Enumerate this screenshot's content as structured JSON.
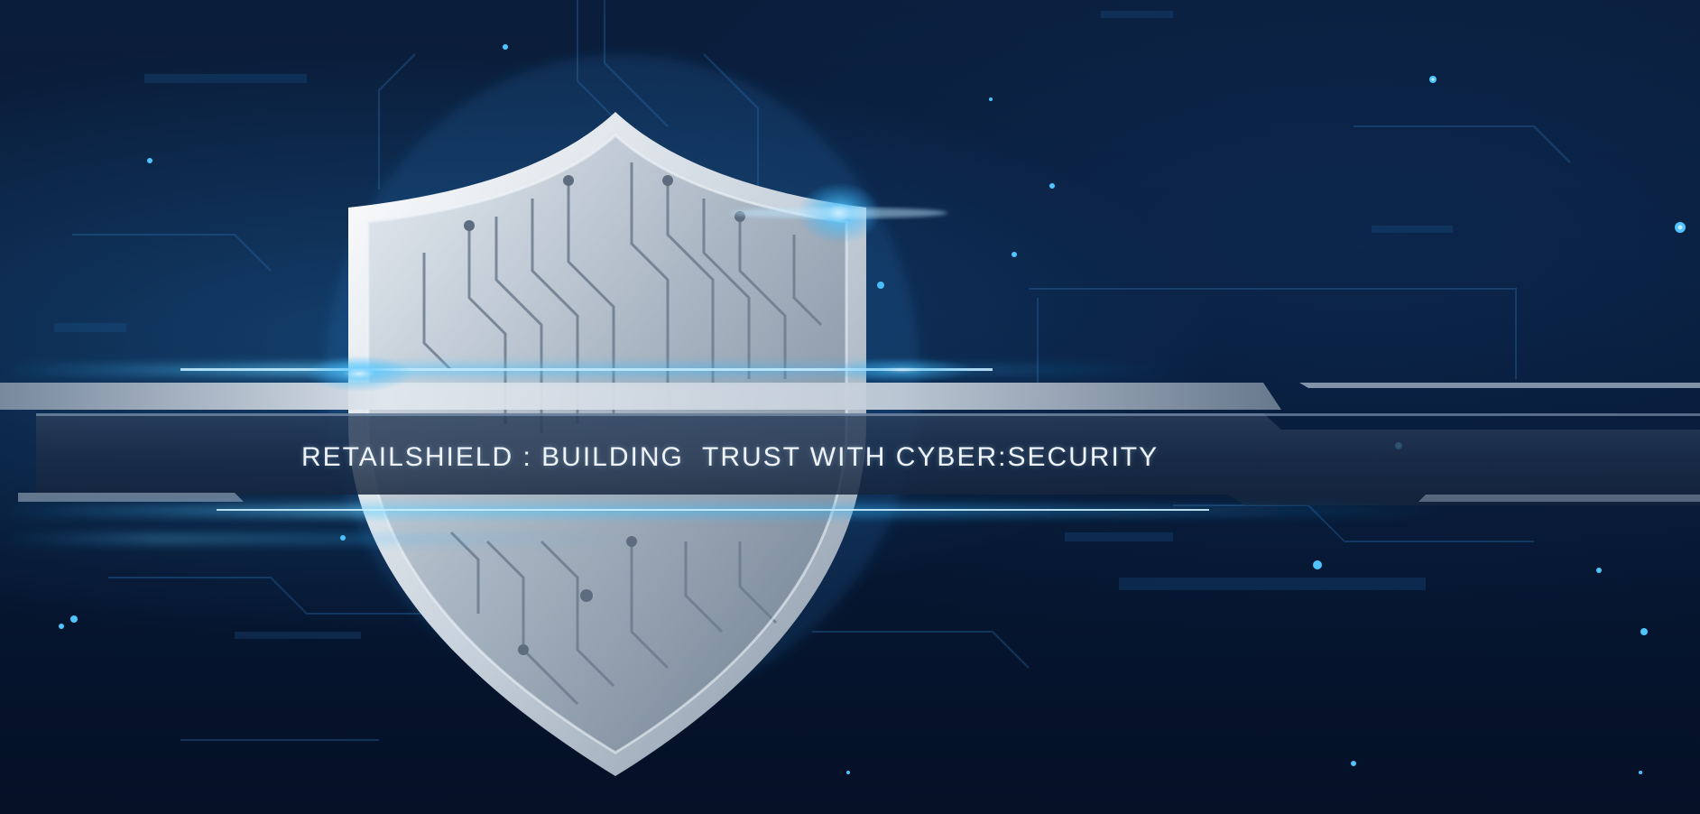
{
  "banner": {
    "title": "RETAILSHIELD : BUILDING  TRUST WITH CYBER:SECURITY"
  },
  "image": {
    "subject": "shield-icon",
    "accent_color": "#2fb4ff",
    "shield_color": "#b9c4cf"
  }
}
